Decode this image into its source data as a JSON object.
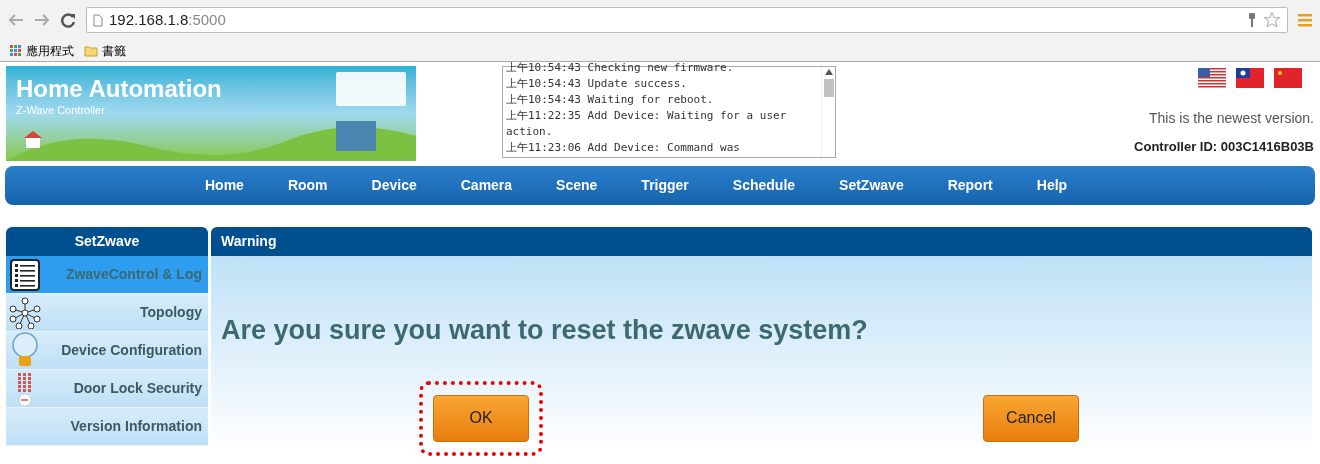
{
  "browser": {
    "url_host": "192.168.1.8",
    "url_port": ":5000",
    "bookmarks": [
      {
        "kind": "apps",
        "label": "應用程式"
      },
      {
        "kind": "folder",
        "label": "書籤"
      }
    ]
  },
  "header": {
    "title": "Home Automation",
    "subtitle": "Z-Wave Controller",
    "log": [
      "上午10:54:43 Checking new firmware.",
      "上午10:54:43 Update success.",
      "上午10:54:43 Waiting for reboot.",
      "上午11:22:35 Add Device: Waiting for a user action.",
      "上午11:23:06 Add Device: Command was"
    ],
    "version_note": "This is the newest version.",
    "controller_id": "Controller ID: 003C1416B03B"
  },
  "nav": [
    "Home",
    "Room",
    "Device",
    "Camera",
    "Scene",
    "Trigger",
    "Schedule",
    "SetZwave",
    "Report",
    "Help"
  ],
  "sidebar": {
    "title": "SetZwave",
    "items": [
      {
        "label": "ZwaveControl & Log",
        "kind": "list",
        "selected": true
      },
      {
        "label": "Topology",
        "kind": "topology",
        "selected": false
      },
      {
        "label": "Device Configuration",
        "kind": "bulb",
        "selected": false
      },
      {
        "label": "Door Lock Security",
        "kind": "keypad",
        "selected": false
      },
      {
        "label": "Version Information",
        "kind": "none",
        "selected": false
      }
    ]
  },
  "dialog": {
    "title": "Warning",
    "question": "Are you sure you want to reset the zwave system?",
    "buttons": [
      {
        "label": "OK",
        "highlighted": true
      },
      {
        "label": "Cancel",
        "highlighted": false
      }
    ]
  }
}
